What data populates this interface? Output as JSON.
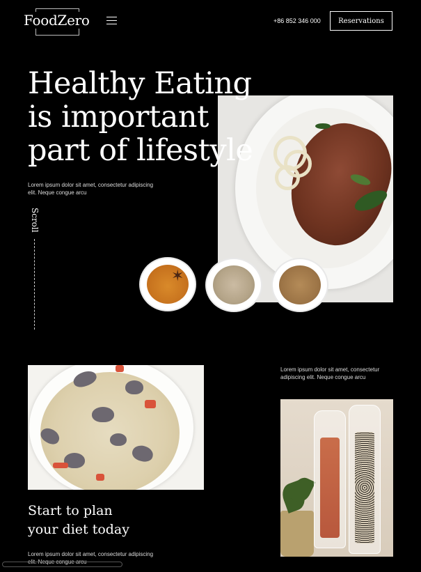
{
  "header": {
    "logo": "FoodZero",
    "menu_icon": "hamburger-menu-icon",
    "phone": "+86 852 346 000",
    "reservations_label": "Reservations"
  },
  "hero": {
    "headline_lines": [
      "Healthy Eating",
      "is important",
      "part of lifestyle"
    ],
    "description": "Lorem ipsum dolor sit amet, consectetur adipiscing elit. Neque congue arcu",
    "scroll_label": "Scroll"
  },
  "images": {
    "hero_photo": "steak-plate-photo",
    "spice_bowls": [
      "turmeric-bowl",
      "peppercorn-bowl",
      "ground-spice-bowl"
    ],
    "soup_photo": "clam-chowder-photo",
    "grinder_photo": "salt-pepper-grinders-photo"
  },
  "colors": {
    "background": "#000000",
    "text": "#ffffff"
  },
  "plan": {
    "side_text": "Lorem ipsum dolor sit amet, consectetur adipiscing elit. Neque congue arcu",
    "title_lines": [
      "Start to plan",
      "your diet today"
    ],
    "description": "Lorem ipsum dolor sit amet, consectetur adipiscing elit. Neque congue arcu"
  }
}
